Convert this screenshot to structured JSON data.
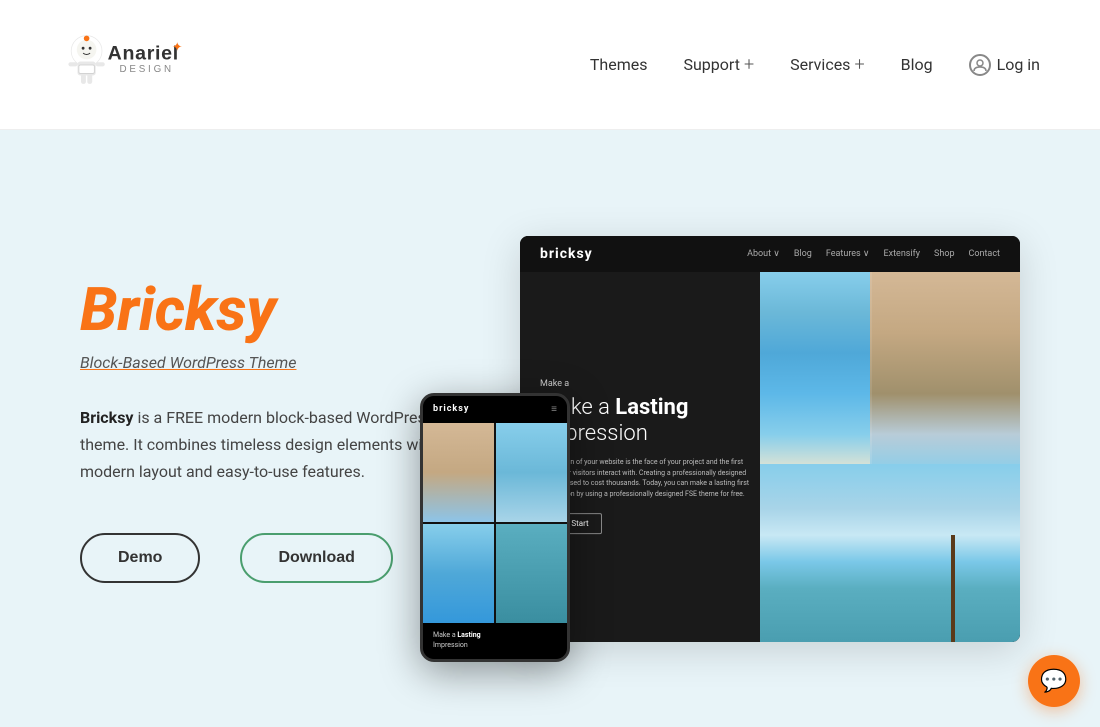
{
  "header": {
    "logo_alt": "Anariel Design",
    "nav": {
      "themes": "Themes",
      "support": "Support",
      "support_plus": "+",
      "services": "Services",
      "services_plus": "+",
      "blog": "Blog",
      "login": "Log in"
    }
  },
  "hero": {
    "title": "Bricksy",
    "subtitle": "Block-Based WordPress Theme",
    "description_bold": "Bricksy",
    "description_text": " is a FREE modern block-based WordPress theme. It combines timeless design elements with a modern layout and easy-to-use features.",
    "btn_demo": "Demo",
    "btn_download": "Download"
  },
  "mockup": {
    "desktop_logo": "bricksy",
    "desktop_nav": [
      "About +",
      "Blog",
      "Features +",
      "Extensify",
      "Shop",
      "Contact"
    ],
    "overlay_pre": "Make a",
    "overlay_heading_1": "Make a",
    "overlay_heading_bold": "Lasting",
    "overlay_heading_2": "Impression",
    "overlay_body": "The design of your website is the face of your project and the first thing your visitors interact with. Creating a professionally designed website used to cost thousands. Today, you can make a lasting first impression by using a professionally designed FSE theme for free.",
    "overlay_btn": "Let's Start",
    "mobile_logo": "bricksy",
    "mobile_caption_1": "Make a",
    "mobile_caption_bold": "Lasting",
    "mobile_caption_2": "Impression"
  }
}
